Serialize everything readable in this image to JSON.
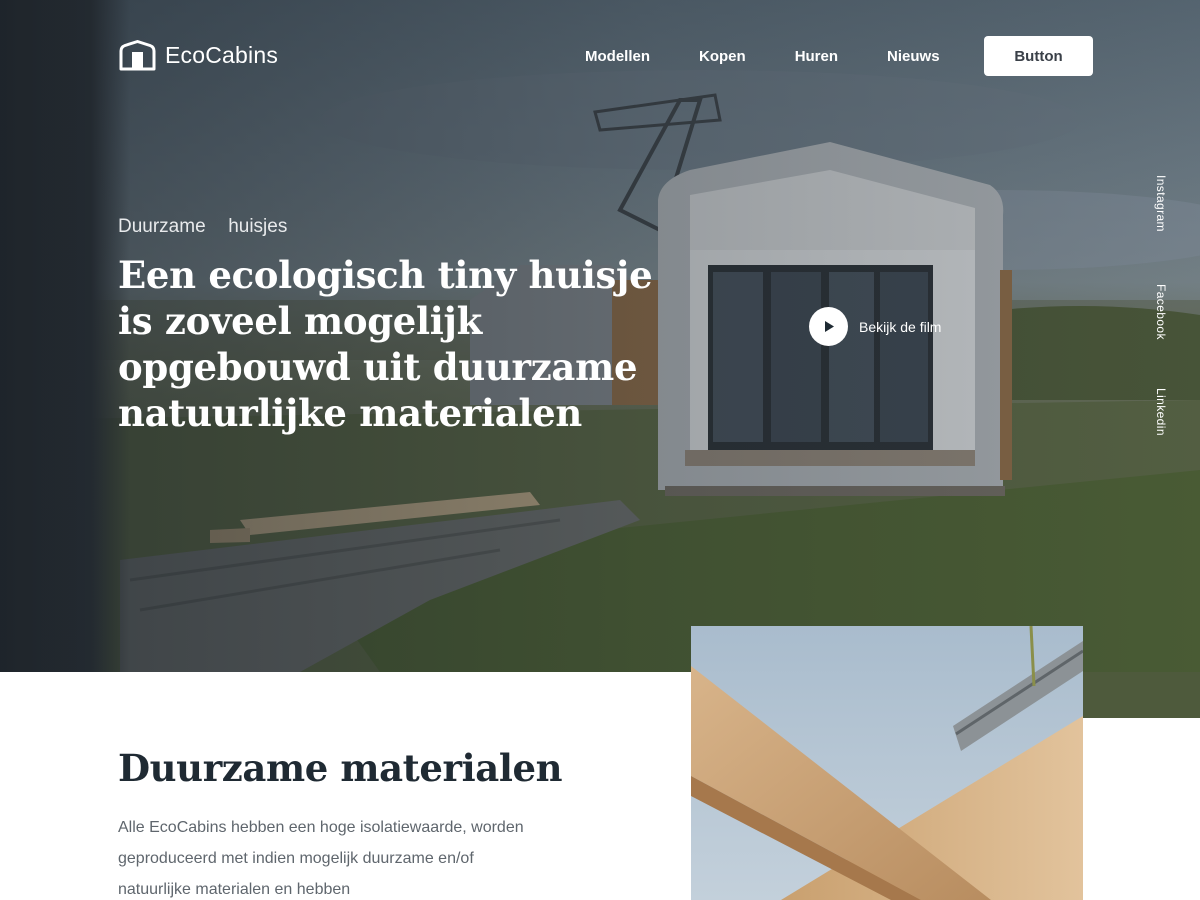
{
  "brand": {
    "name": "EcoCabins"
  },
  "nav": {
    "items": [
      "Modellen",
      "Kopen",
      "Huren",
      "Nieuws"
    ],
    "button_label": "Button"
  },
  "hero": {
    "eyebrow": "Duurzame  huisjes",
    "title": "Een ecologisch tiny huisje is zoveel mogelijk opgebouwd uit duurzame natuurlijke materialen",
    "play_label": "Bekijk de film"
  },
  "social": [
    "Instagram",
    "Facebook",
    "Linkedin"
  ],
  "section": {
    "title": "Duurzame materialen",
    "body": "Alle EcoCabins hebben een hoge isolatiewaarde, worden geproduceerd met indien mogelijk duurzame en/of natuurlijke materialen en hebben"
  },
  "colors": {
    "heading": "#1f2a33",
    "body_text": "#5f666d",
    "button_bg": "#ffffff"
  }
}
